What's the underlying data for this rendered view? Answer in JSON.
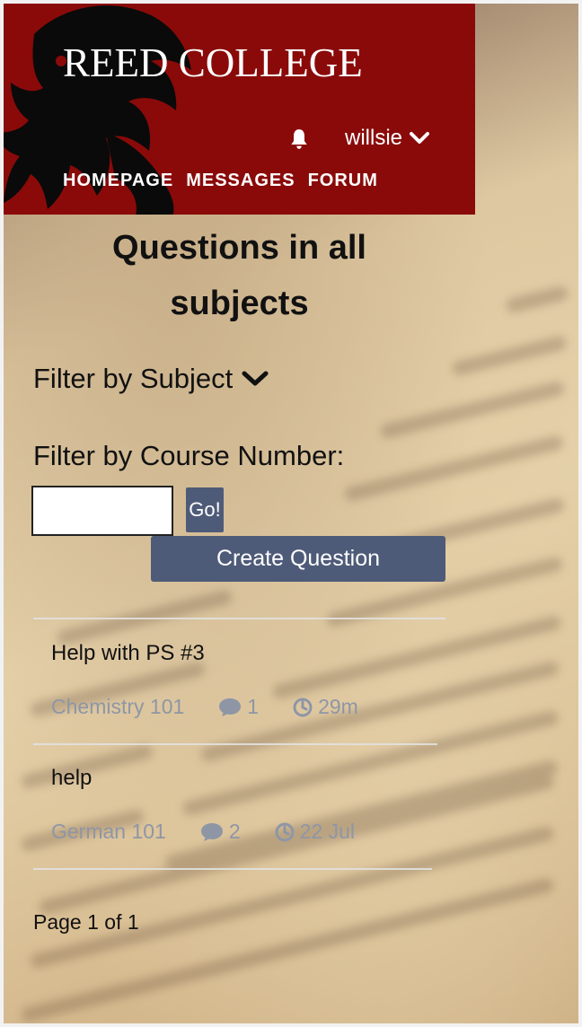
{
  "header": {
    "brand": "REED COLLEGE",
    "username": "willsie",
    "nav": [
      "HOMEPAGE",
      "MESSAGES",
      "FORUM"
    ],
    "colors": {
      "header_bg": "#8a0a0a",
      "button_bg": "#4e5b78",
      "meta_text": "#8e96a6"
    }
  },
  "page": {
    "title_line1": "Questions in all",
    "title_line2": "subjects"
  },
  "filters": {
    "subject_label": "Filter by Subject",
    "course_label": "Filter by Course Number:",
    "course_value": "",
    "go_label": "Go!"
  },
  "actions": {
    "create_label": "Create Question"
  },
  "questions": [
    {
      "title": "Help with PS #3",
      "subject": "Chemistry 101",
      "replies": "1",
      "time": "29m"
    },
    {
      "title": "help",
      "subject": "German 101",
      "replies": "2",
      "time": "22 Jul"
    }
  ],
  "pagination": {
    "text": "Page 1 of 1"
  },
  "icons": {
    "bell": "bell-icon",
    "dropdown": "chevron-down-icon",
    "comment": "comment-icon",
    "clock": "clock-icon",
    "logo": "griffin-logo"
  }
}
